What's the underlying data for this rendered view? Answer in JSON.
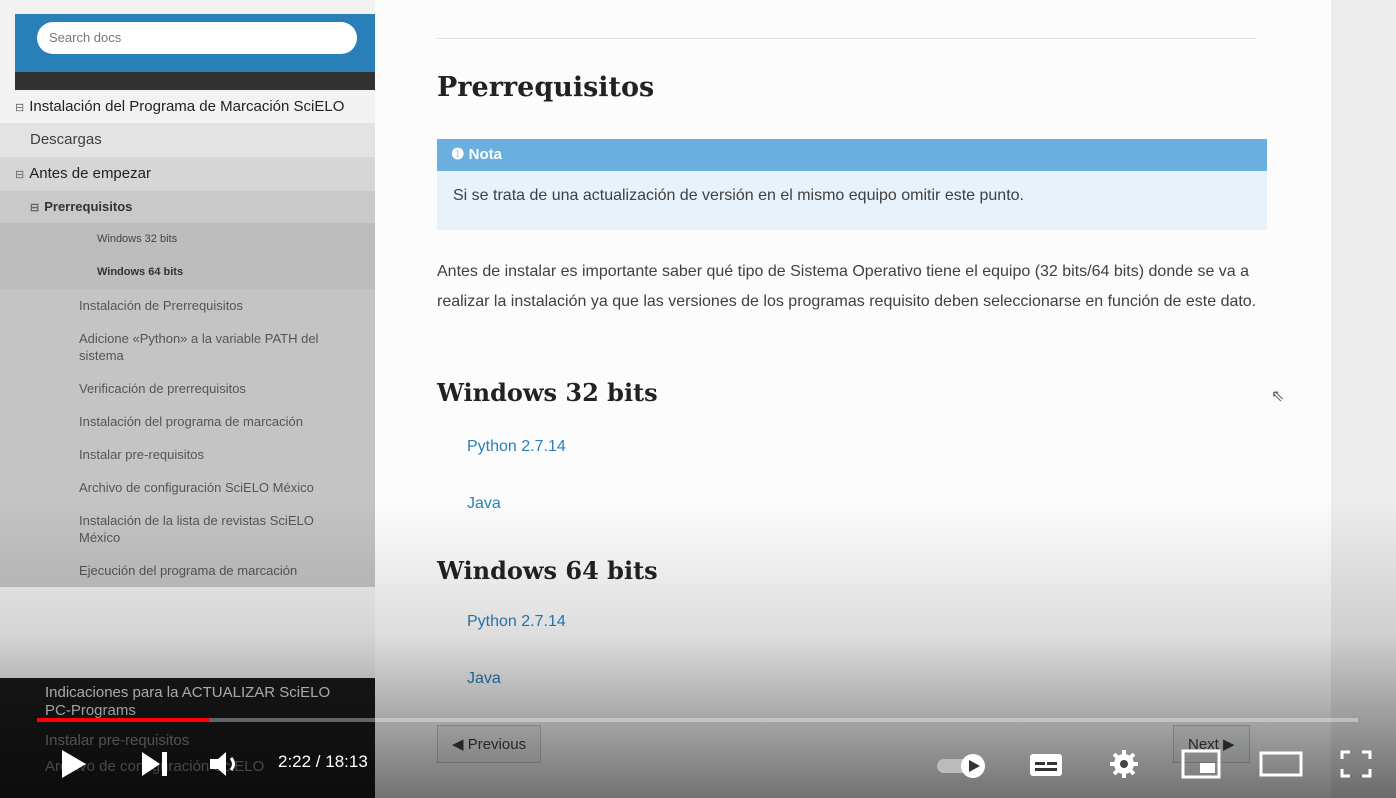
{
  "sidebar": {
    "search_placeholder": "Search docs",
    "items": [
      {
        "label": "Instalación del Programa de Marcación SciELO"
      },
      {
        "label": "Descargas"
      },
      {
        "label": "Antes de empezar"
      },
      {
        "label": "Prerrequisitos"
      },
      {
        "label": "Windows 32 bits"
      },
      {
        "label": "Windows 64 bits"
      },
      {
        "label": "Instalación de Prerrequisitos"
      },
      {
        "label": "Adicione «Python» a la variable PATH del sistema"
      },
      {
        "label": "Verificación de prerrequisitos"
      },
      {
        "label": "Instalación del programa de marcación"
      },
      {
        "label": "Instalar pre-requisitos"
      },
      {
        "label": "Archivo de configuración SciELO México"
      },
      {
        "label": "Instalación de la lista de revistas SciELO México"
      },
      {
        "label": "Ejecución del programa de marcación"
      },
      {
        "label": "Indicaciones para la ACTUALIZAR SciELO PC-Programs"
      },
      {
        "label": "Instalar pre-requisitos"
      },
      {
        "label": "Archivo de configuración SciELO"
      }
    ]
  },
  "content": {
    "title": "Prerrequisitos",
    "note_title": "Nota",
    "note_body": "Si se trata de una actualización de versión en el mismo equipo omitir este punto.",
    "paragraph": "Antes de instalar es importante saber qué tipo de Sistema Operativo tiene el equipo (32 bits/64 bits) donde se va a realizar la instalación ya que las versiones de los programas requisito deben seleccionarse en función de este dato.",
    "section1": {
      "title": "Windows 32 bits",
      "links": [
        "Python 2.7.14",
        "Java"
      ]
    },
    "section2": {
      "title": "Windows 64 bits",
      "links": [
        "Python 2.7.14",
        "Java"
      ]
    },
    "prev_label": "Previous",
    "next_label": "Next"
  },
  "player": {
    "time": "2:22 / 18:13",
    "progress_fraction": 0.13
  }
}
